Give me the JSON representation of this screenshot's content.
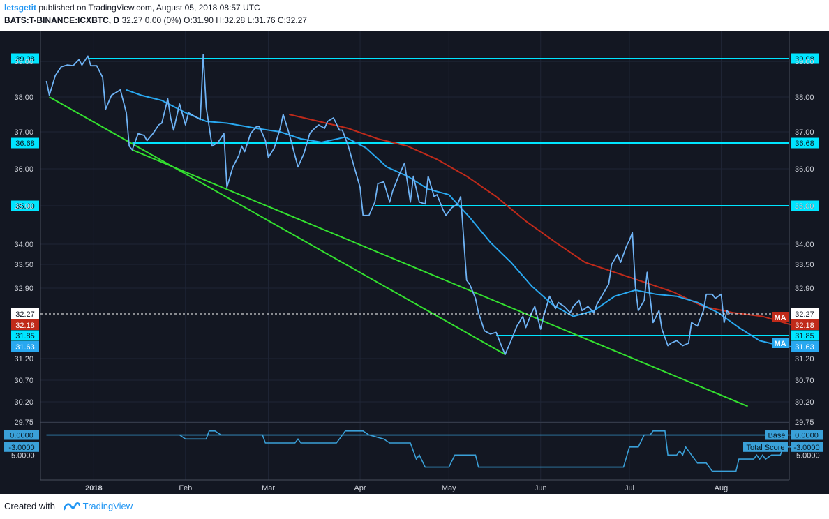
{
  "header": {
    "author": "letsgetit",
    "published": " published on TradingView.com, August 05, 2018 08:57 UTC",
    "symbol": "BATS:T-BINANCE:ICXBTC, D",
    "quote": " 32.27 0.00 (0%) O:31.90 H:32.28 L:31.76 C:32.27"
  },
  "footer": {
    "created_with": "Created with",
    "brand": "TradingView"
  },
  "colors": {
    "background": "#131722",
    "price": "#6fb3f5",
    "ma_short": "#29a8f0",
    "ma_long": "#c02a1a",
    "horizontal_lines": "#00e5ff",
    "trend_lines": "#33e02f",
    "indicator": "#3aa0d8"
  },
  "chart_data": {
    "type": "line",
    "x_tick_labels": [
      "2018",
      "Feb",
      "Mar",
      "Apr",
      "May",
      "Jun",
      "Jul",
      "Aug"
    ],
    "x_ticks": [
      "2018-01-01",
      "2018-02-01",
      "2018-03-01",
      "2018-04-01",
      "2018-05-01",
      "2018-06-01",
      "2018-07-01",
      "2018-08-01"
    ],
    "y_tick_labels": [
      "39.00",
      "38.00",
      "37.00",
      "36.00",
      "35.00",
      "34.00",
      "33.50",
      "32.90",
      "31.20",
      "30.70",
      "30.20",
      "29.75"
    ],
    "y_ticks": [
      39.0,
      38.0,
      37.0,
      36.0,
      35.0,
      34.0,
      33.5,
      32.9,
      31.2,
      30.7,
      30.2,
      29.75
    ],
    "xlim": [
      "2017-12-14",
      "2018-08-24"
    ],
    "grid": true,
    "price_series": [
      {
        "date": "2017-12-16",
        "v": 38.45
      },
      {
        "date": "2017-12-17",
        "v": 38.05
      },
      {
        "date": "2017-12-19",
        "v": 38.6
      },
      {
        "date": "2017-12-21",
        "v": 38.85
      },
      {
        "date": "2017-12-23",
        "v": 38.9
      },
      {
        "date": "2017-12-25",
        "v": 38.88
      },
      {
        "date": "2017-12-27",
        "v": 39.05
      },
      {
        "date": "2017-12-28",
        "v": 38.9
      },
      {
        "date": "2017-12-30",
        "v": 39.15
      },
      {
        "date": "2017-12-31",
        "v": 38.88
      },
      {
        "date": "2018-01-02",
        "v": 38.88
      },
      {
        "date": "2018-01-04",
        "v": 38.55
      },
      {
        "date": "2018-01-05",
        "v": 37.65
      },
      {
        "date": "2018-01-07",
        "v": 38.05
      },
      {
        "date": "2018-01-10",
        "v": 38.2
      },
      {
        "date": "2018-01-12",
        "v": 37.55
      },
      {
        "date": "2018-01-13",
        "v": 36.6
      },
      {
        "date": "2018-01-14",
        "v": 36.5
      },
      {
        "date": "2018-01-16",
        "v": 36.95
      },
      {
        "date": "2018-01-18",
        "v": 36.9
      },
      {
        "date": "2018-01-19",
        "v": 36.75
      },
      {
        "date": "2018-01-21",
        "v": 36.95
      },
      {
        "date": "2018-01-23",
        "v": 37.2
      },
      {
        "date": "2018-01-24",
        "v": 37.25
      },
      {
        "date": "2018-01-26",
        "v": 37.95
      },
      {
        "date": "2018-01-27",
        "v": 37.4
      },
      {
        "date": "2018-01-28",
        "v": 37.05
      },
      {
        "date": "2018-01-30",
        "v": 37.8
      },
      {
        "date": "2018-02-01",
        "v": 37.2
      },
      {
        "date": "2018-02-02",
        "v": 37.55
      },
      {
        "date": "2018-02-04",
        "v": 37.45
      },
      {
        "date": "2018-02-06",
        "v": 37.35
      },
      {
        "date": "2018-02-07",
        "v": 39.2
      },
      {
        "date": "2018-02-08",
        "v": 37.7
      },
      {
        "date": "2018-02-10",
        "v": 36.6
      },
      {
        "date": "2018-02-12",
        "v": 36.7
      },
      {
        "date": "2018-02-14",
        "v": 36.95
      },
      {
        "date": "2018-02-15",
        "v": 35.5
      },
      {
        "date": "2018-02-17",
        "v": 36.05
      },
      {
        "date": "2018-02-19",
        "v": 36.35
      },
      {
        "date": "2018-02-20",
        "v": 36.6
      },
      {
        "date": "2018-02-21",
        "v": 36.45
      },
      {
        "date": "2018-02-23",
        "v": 36.95
      },
      {
        "date": "2018-02-25",
        "v": 37.15
      },
      {
        "date": "2018-02-26",
        "v": 37.15
      },
      {
        "date": "2018-02-28",
        "v": 36.75
      },
      {
        "date": "2018-03-01",
        "v": 36.3
      },
      {
        "date": "2018-03-03",
        "v": 36.55
      },
      {
        "date": "2018-03-05",
        "v": 37.1
      },
      {
        "date": "2018-03-06",
        "v": 37.5
      },
      {
        "date": "2018-03-08",
        "v": 36.95
      },
      {
        "date": "2018-03-10",
        "v": 36.35
      },
      {
        "date": "2018-03-11",
        "v": 36.05
      },
      {
        "date": "2018-03-13",
        "v": 36.4
      },
      {
        "date": "2018-03-15",
        "v": 36.95
      },
      {
        "date": "2018-03-16",
        "v": 37.05
      },
      {
        "date": "2018-03-18",
        "v": 37.2
      },
      {
        "date": "2018-03-20",
        "v": 37.1
      },
      {
        "date": "2018-03-21",
        "v": 37.3
      },
      {
        "date": "2018-03-23",
        "v": 37.4
      },
      {
        "date": "2018-03-25",
        "v": 37.05
      },
      {
        "date": "2018-03-26",
        "v": 37.05
      },
      {
        "date": "2018-03-28",
        "v": 36.6
      },
      {
        "date": "2018-03-30",
        "v": 36.05
      },
      {
        "date": "2018-04-01",
        "v": 35.5
      },
      {
        "date": "2018-04-02",
        "v": 34.75
      },
      {
        "date": "2018-04-04",
        "v": 34.75
      },
      {
        "date": "2018-04-06",
        "v": 35.1
      },
      {
        "date": "2018-04-07",
        "v": 35.6
      },
      {
        "date": "2018-04-09",
        "v": 35.65
      },
      {
        "date": "2018-04-11",
        "v": 35.1
      },
      {
        "date": "2018-04-12",
        "v": 35.4
      },
      {
        "date": "2018-04-14",
        "v": 35.8
      },
      {
        "date": "2018-04-16",
        "v": 36.15
      },
      {
        "date": "2018-04-18",
        "v": 35.1
      },
      {
        "date": "2018-04-19",
        "v": 35.8
      },
      {
        "date": "2018-04-21",
        "v": 35.1
      },
      {
        "date": "2018-04-23",
        "v": 35.05
      },
      {
        "date": "2018-04-24",
        "v": 35.8
      },
      {
        "date": "2018-04-26",
        "v": 35.25
      },
      {
        "date": "2018-04-27",
        "v": 35.3
      },
      {
        "date": "2018-04-29",
        "v": 34.9
      },
      {
        "date": "2018-04-30",
        "v": 34.75
      },
      {
        "date": "2018-05-02",
        "v": 34.95
      },
      {
        "date": "2018-05-04",
        "v": 35.05
      },
      {
        "date": "2018-05-05",
        "v": 35.25
      },
      {
        "date": "2018-05-07",
        "v": 33.1
      },
      {
        "date": "2018-05-08",
        "v": 33.0
      },
      {
        "date": "2018-05-10",
        "v": 32.65
      },
      {
        "date": "2018-05-11",
        "v": 32.3
      },
      {
        "date": "2018-05-13",
        "v": 32.0
      },
      {
        "date": "2018-05-15",
        "v": 31.9
      },
      {
        "date": "2018-05-17",
        "v": 31.95
      },
      {
        "date": "2018-05-19",
        "v": 31.6
      },
      {
        "date": "2018-05-20",
        "v": 31.35
      },
      {
        "date": "2018-05-22",
        "v": 31.75
      },
      {
        "date": "2018-05-24",
        "v": 32.15
      },
      {
        "date": "2018-05-26",
        "v": 32.25
      },
      {
        "date": "2018-05-27",
        "v": 32.1
      },
      {
        "date": "2018-05-29",
        "v": 32.3
      },
      {
        "date": "2018-05-30",
        "v": 32.45
      },
      {
        "date": "2018-06-01",
        "v": 32.05
      },
      {
        "date": "2018-06-02",
        "v": 32.25
      },
      {
        "date": "2018-06-04",
        "v": 32.7
      },
      {
        "date": "2018-06-06",
        "v": 32.4
      },
      {
        "date": "2018-06-07",
        "v": 32.55
      },
      {
        "date": "2018-06-09",
        "v": 32.45
      },
      {
        "date": "2018-06-11",
        "v": 32.3
      },
      {
        "date": "2018-06-12",
        "v": 32.45
      },
      {
        "date": "2018-06-14",
        "v": 32.6
      },
      {
        "date": "2018-06-15",
        "v": 32.35
      },
      {
        "date": "2018-06-17",
        "v": 32.45
      },
      {
        "date": "2018-06-19",
        "v": 32.3
      },
      {
        "date": "2018-06-20",
        "v": 32.5
      },
      {
        "date": "2018-06-22",
        "v": 32.75
      },
      {
        "date": "2018-06-24",
        "v": 33.0
      },
      {
        "date": "2018-06-25",
        "v": 33.5
      },
      {
        "date": "2018-06-27",
        "v": 33.75
      },
      {
        "date": "2018-06-28",
        "v": 33.55
      },
      {
        "date": "2018-06-30",
        "v": 33.95
      },
      {
        "date": "2018-07-01",
        "v": 34.1
      },
      {
        "date": "2018-07-02",
        "v": 34.3
      },
      {
        "date": "2018-07-03",
        "v": 32.95
      },
      {
        "date": "2018-07-04",
        "v": 32.35
      },
      {
        "date": "2018-07-06",
        "v": 32.6
      },
      {
        "date": "2018-07-07",
        "v": 33.3
      },
      {
        "date": "2018-07-09",
        "v": 32.2
      },
      {
        "date": "2018-07-11",
        "v": 32.35
      },
      {
        "date": "2018-07-12",
        "v": 32.05
      },
      {
        "date": "2018-07-14",
        "v": 31.65
      },
      {
        "date": "2018-07-15",
        "v": 31.7
      },
      {
        "date": "2018-07-17",
        "v": 31.75
      },
      {
        "date": "2018-07-19",
        "v": 31.65
      },
      {
        "date": "2018-07-21",
        "v": 31.7
      },
      {
        "date": "2018-07-22",
        "v": 32.2
      },
      {
        "date": "2018-07-24",
        "v": 32.15
      },
      {
        "date": "2018-07-26",
        "v": 32.35
      },
      {
        "date": "2018-07-27",
        "v": 32.75
      },
      {
        "date": "2018-07-29",
        "v": 32.75
      },
      {
        "date": "2018-07-30",
        "v": 32.65
      },
      {
        "date": "2018-08-01",
        "v": 32.75
      },
      {
        "date": "2018-08-02",
        "v": 32.2
      },
      {
        "date": "2018-08-03",
        "v": 32.35
      },
      {
        "date": "2018-08-04",
        "v": 32.27
      }
    ],
    "ma_short_series": [
      {
        "date": "2018-01-12",
        "v": 38.2
      },
      {
        "date": "2018-01-17",
        "v": 38.05
      },
      {
        "date": "2018-01-24",
        "v": 37.9
      },
      {
        "date": "2018-02-01",
        "v": 37.55
      },
      {
        "date": "2018-02-08",
        "v": 37.3
      },
      {
        "date": "2018-02-15",
        "v": 37.25
      },
      {
        "date": "2018-02-25",
        "v": 37.1
      },
      {
        "date": "2018-03-05",
        "v": 37.0
      },
      {
        "date": "2018-03-12",
        "v": 36.8
      },
      {
        "date": "2018-03-19",
        "v": 36.7
      },
      {
        "date": "2018-03-27",
        "v": 36.85
      },
      {
        "date": "2018-04-03",
        "v": 36.55
      },
      {
        "date": "2018-04-10",
        "v": 36.05
      },
      {
        "date": "2018-04-17",
        "v": 35.8
      },
      {
        "date": "2018-04-24",
        "v": 35.45
      },
      {
        "date": "2018-05-01",
        "v": 35.3
      },
      {
        "date": "2018-05-08",
        "v": 34.7
      },
      {
        "date": "2018-05-15",
        "v": 34.05
      },
      {
        "date": "2018-05-22",
        "v": 33.55
      },
      {
        "date": "2018-05-29",
        "v": 32.95
      },
      {
        "date": "2018-06-05",
        "v": 32.5
      },
      {
        "date": "2018-06-12",
        "v": 32.25
      },
      {
        "date": "2018-06-19",
        "v": 32.35
      },
      {
        "date": "2018-06-26",
        "v": 32.7
      },
      {
        "date": "2018-07-03",
        "v": 32.85
      },
      {
        "date": "2018-07-10",
        "v": 32.75
      },
      {
        "date": "2018-07-17",
        "v": 32.7
      },
      {
        "date": "2018-07-24",
        "v": 32.55
      },
      {
        "date": "2018-07-31",
        "v": 32.3
      },
      {
        "date": "2018-08-07",
        "v": 32.1
      },
      {
        "date": "2018-08-14",
        "v": 31.75
      },
      {
        "date": "2018-08-21",
        "v": 31.65
      },
      {
        "date": "2018-08-25",
        "v": 31.63
      }
    ],
    "ma_long_series": [
      {
        "date": "2018-03-08",
        "v": 37.5
      },
      {
        "date": "2018-03-18",
        "v": 37.3
      },
      {
        "date": "2018-03-28",
        "v": 37.1
      },
      {
        "date": "2018-04-07",
        "v": 36.8
      },
      {
        "date": "2018-04-17",
        "v": 36.6
      },
      {
        "date": "2018-04-27",
        "v": 36.25
      },
      {
        "date": "2018-05-07",
        "v": 35.8
      },
      {
        "date": "2018-05-17",
        "v": 35.25
      },
      {
        "date": "2018-05-27",
        "v": 34.6
      },
      {
        "date": "2018-06-06",
        "v": 34.05
      },
      {
        "date": "2018-06-16",
        "v": 33.55
      },
      {
        "date": "2018-06-26",
        "v": 33.3
      },
      {
        "date": "2018-07-06",
        "v": 33.05
      },
      {
        "date": "2018-07-16",
        "v": 32.8
      },
      {
        "date": "2018-07-26",
        "v": 32.45
      },
      {
        "date": "2018-08-05",
        "v": 32.3
      },
      {
        "date": "2018-08-15",
        "v": 32.25
      },
      {
        "date": "2018-08-25",
        "v": 32.18
      }
    ],
    "horizontal_levels": [
      {
        "label": "39.08",
        "y": 39.08,
        "from": "2017-12-30",
        "to": "2018-08-24"
      },
      {
        "label": "36.68",
        "y": 36.68,
        "from": "2018-01-14",
        "to": "2018-08-24"
      },
      {
        "label": "35.00",
        "y": 35.0,
        "from": "2018-04-06",
        "to": "2018-08-24"
      },
      {
        "label": "31.85",
        "y": 31.85,
        "from": "2018-05-17",
        "to": "2018-08-24"
      }
    ],
    "trend_lines": [
      {
        "from": {
          "date": "2017-12-17",
          "v": 38.0
        },
        "to": {
          "date": "2018-05-20",
          "v": 31.35
        }
      },
      {
        "from": {
          "date": "2018-01-14",
          "v": 36.5
        },
        "to": {
          "date": "2018-08-10",
          "v": 30.1
        }
      }
    ],
    "last_price": {
      "label": "32.27",
      "v": 32.27
    },
    "ma_labels": [
      {
        "text": "MA",
        "value_label": "32.18",
        "v": 32.18,
        "color": "#c02a1a"
      },
      {
        "text": "MA",
        "value_label": "31.63",
        "v": 31.63,
        "color": "#29a8f0"
      }
    ],
    "indicator": {
      "legend": [
        {
          "name": "Base",
          "value_label": "0.0000"
        },
        {
          "name": "Total Score",
          "value_label": "-3.0000"
        }
      ],
      "y_tick_labels": [
        "0.0000",
        "-3.0000",
        "-5.0000"
      ],
      "ylim": [
        -10.5,
        2.0
      ],
      "base_value": 0,
      "score_series": [
        {
          "date": "2018-01-30",
          "v": 0
        },
        {
          "date": "2018-02-01",
          "v": -1
        },
        {
          "date": "2018-02-08",
          "v": -1
        },
        {
          "date": "2018-02-09",
          "v": 1
        },
        {
          "date": "2018-02-11",
          "v": 1
        },
        {
          "date": "2018-02-13",
          "v": 0
        },
        {
          "date": "2018-02-27",
          "v": 0
        },
        {
          "date": "2018-02-28",
          "v": -2
        },
        {
          "date": "2018-03-10",
          "v": -2
        },
        {
          "date": "2018-03-11",
          "v": -1
        },
        {
          "date": "2018-03-12",
          "v": -2
        },
        {
          "date": "2018-03-24",
          "v": -2
        },
        {
          "date": "2018-03-25",
          "v": -1
        },
        {
          "date": "2018-03-27",
          "v": 1
        },
        {
          "date": "2018-04-02",
          "v": 1
        },
        {
          "date": "2018-04-04",
          "v": 0
        },
        {
          "date": "2018-04-09",
          "v": -1
        },
        {
          "date": "2018-04-11",
          "v": -2
        },
        {
          "date": "2018-04-18",
          "v": -2
        },
        {
          "date": "2018-04-20",
          "v": -6
        },
        {
          "date": "2018-04-21",
          "v": -5
        },
        {
          "date": "2018-04-23",
          "v": -8
        },
        {
          "date": "2018-05-01",
          "v": -8
        },
        {
          "date": "2018-05-03",
          "v": -5
        },
        {
          "date": "2018-05-10",
          "v": -5
        },
        {
          "date": "2018-05-11",
          "v": -8
        },
        {
          "date": "2018-06-29",
          "v": -8
        },
        {
          "date": "2018-07-01",
          "v": -3
        },
        {
          "date": "2018-07-04",
          "v": -3
        },
        {
          "date": "2018-07-06",
          "v": 0
        },
        {
          "date": "2018-07-08",
          "v": 0
        },
        {
          "date": "2018-07-09",
          "v": 1
        },
        {
          "date": "2018-07-13",
          "v": 1
        },
        {
          "date": "2018-07-14",
          "v": -5
        },
        {
          "date": "2018-07-17",
          "v": -5
        },
        {
          "date": "2018-07-18",
          "v": -4
        },
        {
          "date": "2018-07-19",
          "v": -5
        },
        {
          "date": "2018-07-20",
          "v": -3
        },
        {
          "date": "2018-07-22",
          "v": -5
        },
        {
          "date": "2018-07-24",
          "v": -7
        },
        {
          "date": "2018-07-27",
          "v": -7
        },
        {
          "date": "2018-07-29",
          "v": -9
        },
        {
          "date": "2018-08-06",
          "v": -9
        },
        {
          "date": "2018-08-07",
          "v": -6
        },
        {
          "date": "2018-08-12",
          "v": -6
        },
        {
          "date": "2018-08-13",
          "v": -5
        },
        {
          "date": "2018-08-14",
          "v": -6
        },
        {
          "date": "2018-08-15",
          "v": -5
        },
        {
          "date": "2018-08-16",
          "v": -6
        },
        {
          "date": "2018-08-18",
          "v": -5
        },
        {
          "date": "2018-08-21",
          "v": -5
        },
        {
          "date": "2018-08-22",
          "v": -3
        },
        {
          "date": "2018-08-25",
          "v": -3
        }
      ]
    }
  }
}
